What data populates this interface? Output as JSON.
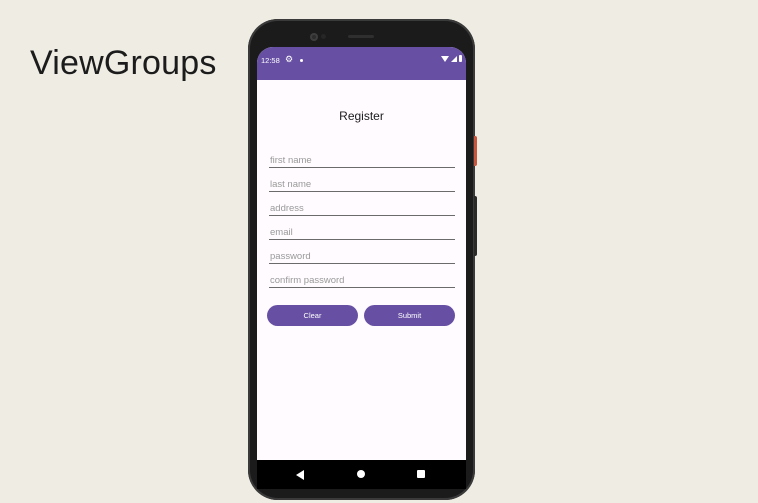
{
  "slide": {
    "title": "ViewGroups"
  },
  "status_bar": {
    "time": "12:58",
    "icons": [
      "gear-icon",
      "notification-dot-icon",
      "wifi-icon",
      "signal-icon",
      "battery-icon"
    ]
  },
  "form": {
    "title": "Register",
    "fields": [
      {
        "placeholder": "first name",
        "value": ""
      },
      {
        "placeholder": "last name",
        "value": ""
      },
      {
        "placeholder": "address",
        "value": ""
      },
      {
        "placeholder": "email",
        "value": ""
      },
      {
        "placeholder": "password",
        "value": ""
      },
      {
        "placeholder": "confirm password",
        "value": ""
      }
    ],
    "clear_label": "Clear",
    "submit_label": "Submit"
  },
  "nav_bar": {
    "icons": [
      "back-icon",
      "home-icon",
      "recent-apps-icon"
    ]
  },
  "colors": {
    "background": "#efece3",
    "primary": "#6750a4",
    "screen": "#fffbfe",
    "phone_frame": "#1b1b1b",
    "side_button_accent": "#c8553d"
  }
}
